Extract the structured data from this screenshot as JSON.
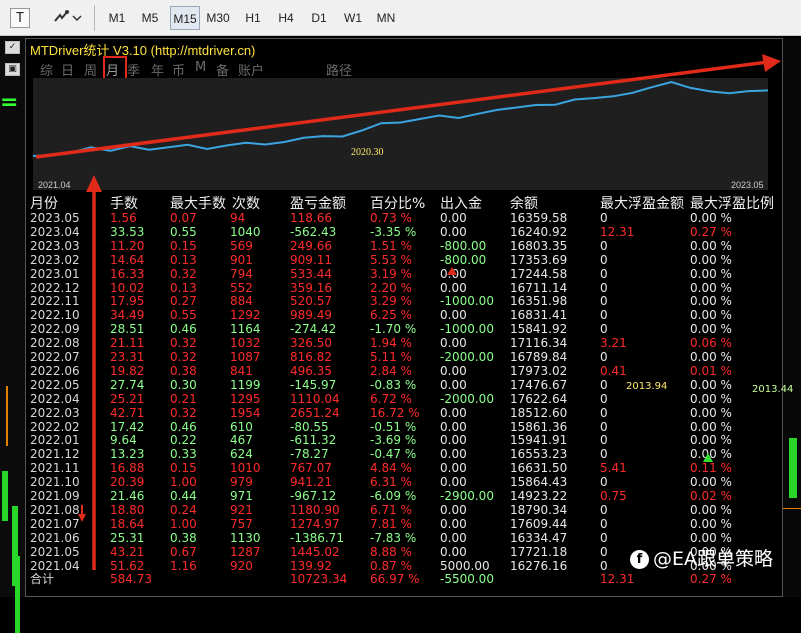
{
  "toolbar": {
    "timeframes": [
      "M1",
      "M5",
      "M15",
      "M30",
      "H1",
      "H4",
      "D1",
      "W1",
      "MN"
    ],
    "active_timeframe": "M15",
    "text_icon_label": "T"
  },
  "window": {
    "title": "MTDriver统计   V3.10 (http://mtdriver.cn)"
  },
  "menu": {
    "items": [
      "综",
      "日",
      "周",
      "月",
      "季",
      "年",
      "币",
      "M",
      "备",
      "账户",
      "路径"
    ],
    "selected": "月"
  },
  "chart_data": {
    "type": "line",
    "x_start_label": "2021.04",
    "x_end_label": "2023.05",
    "annotation": "2020.30",
    "line_color": "#3aa5e0",
    "trend_arrow_color": "#e02a1a",
    "values": [
      0,
      3,
      10,
      25,
      15,
      28,
      18,
      25,
      32,
      20,
      30,
      38,
      33,
      40,
      52,
      57,
      56,
      73,
      94,
      96,
      106,
      116,
      109,
      121,
      132,
      139,
      146,
      147,
      162,
      166,
      171,
      181,
      197,
      212,
      195,
      185,
      180,
      186,
      188
    ]
  },
  "table": {
    "headers": [
      "月份",
      "手数",
      "最大手数",
      "次数",
      "盈亏金额",
      "百分比%",
      "出入金",
      "余额",
      "最大浮盈金额",
      "最大浮盈比例"
    ],
    "rows": [
      {
        "month": "2023.05",
        "lots": "1.56",
        "maxlots": "0.07",
        "count": "94",
        "pnl": "118.66",
        "pct": "0.73 %",
        "flow": "0.00",
        "balance": "16359.58",
        "maxfloat": "0",
        "maxfloatpct": "0.00 %",
        "c": "neg"
      },
      {
        "month": "2023.04",
        "lots": "33.53",
        "maxlots": "0.55",
        "count": "1040",
        "pnl": "-562.43",
        "pct": "-3.35 %",
        "flow": "0.00",
        "balance": "16240.92",
        "maxfloat": "12.31",
        "maxfloatpct": "0.27 %",
        "c": "pos"
      },
      {
        "month": "2023.03",
        "lots": "11.20",
        "maxlots": "0.15",
        "count": "569",
        "pnl": "249.66",
        "pct": "1.51 %",
        "flow": "-800.00",
        "balance": "16803.35",
        "maxfloat": "0",
        "maxfloatpct": "0.00 %",
        "c": "neg"
      },
      {
        "month": "2023.02",
        "lots": "14.64",
        "maxlots": "0.13",
        "count": "901",
        "pnl": "909.11",
        "pct": "5.53 %",
        "flow": "-800.00",
        "balance": "17353.69",
        "maxfloat": "0",
        "maxfloatpct": "0.00 %",
        "c": "neg"
      },
      {
        "month": "2023.01",
        "lots": "16.33",
        "maxlots": "0.32",
        "count": "794",
        "pnl": "533.44",
        "pct": "3.19 %",
        "flow": "0.00",
        "balance": "17244.58",
        "maxfloat": "0",
        "maxfloatpct": "0.00 %",
        "c": "neg"
      },
      {
        "month": "2022.12",
        "lots": "10.02",
        "maxlots": "0.13",
        "count": "552",
        "pnl": "359.16",
        "pct": "2.20 %",
        "flow": "0.00",
        "balance": "16711.14",
        "maxfloat": "0",
        "maxfloatpct": "0.00 %",
        "c": "neg"
      },
      {
        "month": "2022.11",
        "lots": "17.95",
        "maxlots": "0.27",
        "count": "884",
        "pnl": "520.57",
        "pct": "3.29 %",
        "flow": "-1000.00",
        "balance": "16351.98",
        "maxfloat": "0",
        "maxfloatpct": "0.00 %",
        "c": "neg"
      },
      {
        "month": "2022.10",
        "lots": "34.49",
        "maxlots": "0.55",
        "count": "1292",
        "pnl": "989.49",
        "pct": "6.25 %",
        "flow": "0.00",
        "balance": "16831.41",
        "maxfloat": "0",
        "maxfloatpct": "0.00 %",
        "c": "neg"
      },
      {
        "month": "2022.09",
        "lots": "28.51",
        "maxlots": "0.46",
        "count": "1164",
        "pnl": "-274.42",
        "pct": "-1.70 %",
        "flow": "-1000.00",
        "balance": "15841.92",
        "maxfloat": "0",
        "maxfloatpct": "0.00 %",
        "c": "pos"
      },
      {
        "month": "2022.08",
        "lots": "21.11",
        "maxlots": "0.32",
        "count": "1032",
        "pnl": "326.50",
        "pct": "1.94 %",
        "flow": "0.00",
        "balance": "17116.34",
        "maxfloat": "3.21",
        "maxfloatpct": "0.06 %",
        "c": "neg"
      },
      {
        "month": "2022.07",
        "lots": "23.31",
        "maxlots": "0.32",
        "count": "1087",
        "pnl": "816.82",
        "pct": "5.11 %",
        "flow": "-2000.00",
        "balance": "16789.84",
        "maxfloat": "0",
        "maxfloatpct": "0.00 %",
        "c": "neg"
      },
      {
        "month": "2022.06",
        "lots": "19.82",
        "maxlots": "0.38",
        "count": "841",
        "pnl": "496.35",
        "pct": "2.84 %",
        "flow": "0.00",
        "balance": "17973.02",
        "maxfloat": "0.41",
        "maxfloatpct": "0.01 %",
        "c": "neg"
      },
      {
        "month": "2022.05",
        "lots": "27.74",
        "maxlots": "0.30",
        "count": "1199",
        "pnl": "-145.97",
        "pct": "-0.83 %",
        "flow": "0.00",
        "balance": "17476.67",
        "maxfloat": "0",
        "maxfloatpct": "0.00 %",
        "c": "pos"
      },
      {
        "month": "2022.04",
        "lots": "25.21",
        "maxlots": "0.21",
        "count": "1295",
        "pnl": "1110.04",
        "pct": "6.72 %",
        "flow": "-2000.00",
        "balance": "17622.64",
        "maxfloat": "0",
        "maxfloatpct": "0.00 %",
        "c": "neg"
      },
      {
        "month": "2022.03",
        "lots": "42.71",
        "maxlots": "0.32",
        "count": "1954",
        "pnl": "2651.24",
        "pct": "16.72 %",
        "flow": "0.00",
        "balance": "18512.60",
        "maxfloat": "0",
        "maxfloatpct": "0.00 %",
        "c": "neg"
      },
      {
        "month": "2022.02",
        "lots": "17.42",
        "maxlots": "0.46",
        "count": "610",
        "pnl": "-80.55",
        "pct": "-0.51 %",
        "flow": "0.00",
        "balance": "15861.36",
        "maxfloat": "0",
        "maxfloatpct": "0.00 %",
        "c": "pos"
      },
      {
        "month": "2022.01",
        "lots": "9.64",
        "maxlots": "0.22",
        "count": "467",
        "pnl": "-611.32",
        "pct": "-3.69 %",
        "flow": "0.00",
        "balance": "15941.91",
        "maxfloat": "0",
        "maxfloatpct": "0.00 %",
        "c": "pos"
      },
      {
        "month": "2021.12",
        "lots": "13.23",
        "maxlots": "0.33",
        "count": "624",
        "pnl": "-78.27",
        "pct": "-0.47 %",
        "flow": "0.00",
        "balance": "16553.23",
        "maxfloat": "0",
        "maxfloatpct": "0.00 %",
        "c": "pos"
      },
      {
        "month": "2021.11",
        "lots": "16.88",
        "maxlots": "0.15",
        "count": "1010",
        "pnl": "767.07",
        "pct": "4.84 %",
        "flow": "0.00",
        "balance": "16631.50",
        "maxfloat": "5.41",
        "maxfloatpct": "0.11 %",
        "c": "neg"
      },
      {
        "month": "2021.10",
        "lots": "20.39",
        "maxlots": "1.00",
        "count": "979",
        "pnl": "941.21",
        "pct": "6.31 %",
        "flow": "0.00",
        "balance": "15864.43",
        "maxfloat": "0",
        "maxfloatpct": "0.00 %",
        "c": "neg"
      },
      {
        "month": "2021.09",
        "lots": "21.46",
        "maxlots": "0.44",
        "count": "971",
        "pnl": "-967.12",
        "pct": "-6.09 %",
        "flow": "-2900.00",
        "balance": "14923.22",
        "maxfloat": "0.75",
        "maxfloatpct": "0.02 %",
        "c": "pos"
      },
      {
        "month": "2021.08",
        "lots": "18.80",
        "maxlots": "0.24",
        "count": "921",
        "pnl": "1180.90",
        "pct": "6.71 %",
        "flow": "0.00",
        "balance": "18790.34",
        "maxfloat": "0",
        "maxfloatpct": "0.00 %",
        "c": "neg"
      },
      {
        "month": "2021.07",
        "lots": "18.64",
        "maxlots": "1.00",
        "count": "757",
        "pnl": "1274.97",
        "pct": "7.81 %",
        "flow": "0.00",
        "balance": "17609.44",
        "maxfloat": "0",
        "maxfloatpct": "0.00 %",
        "c": "neg"
      },
      {
        "month": "2021.06",
        "lots": "25.31",
        "maxlots": "0.38",
        "count": "1130",
        "pnl": "-1386.71",
        "pct": "-7.83 %",
        "flow": "0.00",
        "balance": "16334.47",
        "maxfloat": "0",
        "maxfloatpct": "0.00 %",
        "c": "pos"
      },
      {
        "month": "2021.05",
        "lots": "43.21",
        "maxlots": "0.67",
        "count": "1287",
        "pnl": "1445.02",
        "pct": "8.88 %",
        "flow": "0.00",
        "balance": "17721.18",
        "maxfloat": "0",
        "maxfloatpct": "0.00 %",
        "c": "neg"
      },
      {
        "month": "2021.04",
        "lots": "51.62",
        "maxlots": "1.16",
        "count": "920",
        "pnl": "139.92",
        "pct": "0.87 %",
        "flow": "5000.00",
        "balance": "16276.16",
        "maxfloat": "0",
        "maxfloatpct": "0.00 %",
        "c": "neg"
      }
    ],
    "total": {
      "month": "合计",
      "lots": "584.73",
      "maxlots": "",
      "count": "",
      "pnl": "10723.34",
      "pct": "66.97 %",
      "flow": "-5500.00",
      "balance": "",
      "maxfloat": "12.31",
      "maxfloatpct": "0.27 %"
    }
  },
  "annotations": {
    "mid": "2013.94",
    "right": "2013.44"
  },
  "watermark": {
    "logo": "f",
    "text": "@EA跟单策略"
  },
  "colors": {
    "positive": "#8cff8c",
    "negative": "#ff2b2b",
    "title": "#ffe23d",
    "highlight": "#e02a1a"
  },
  "icons": [
    "text-tool-icon",
    "objects-tool-icon",
    "chevron-down-icon",
    "checkbox-icon",
    "expand-icon"
  ]
}
